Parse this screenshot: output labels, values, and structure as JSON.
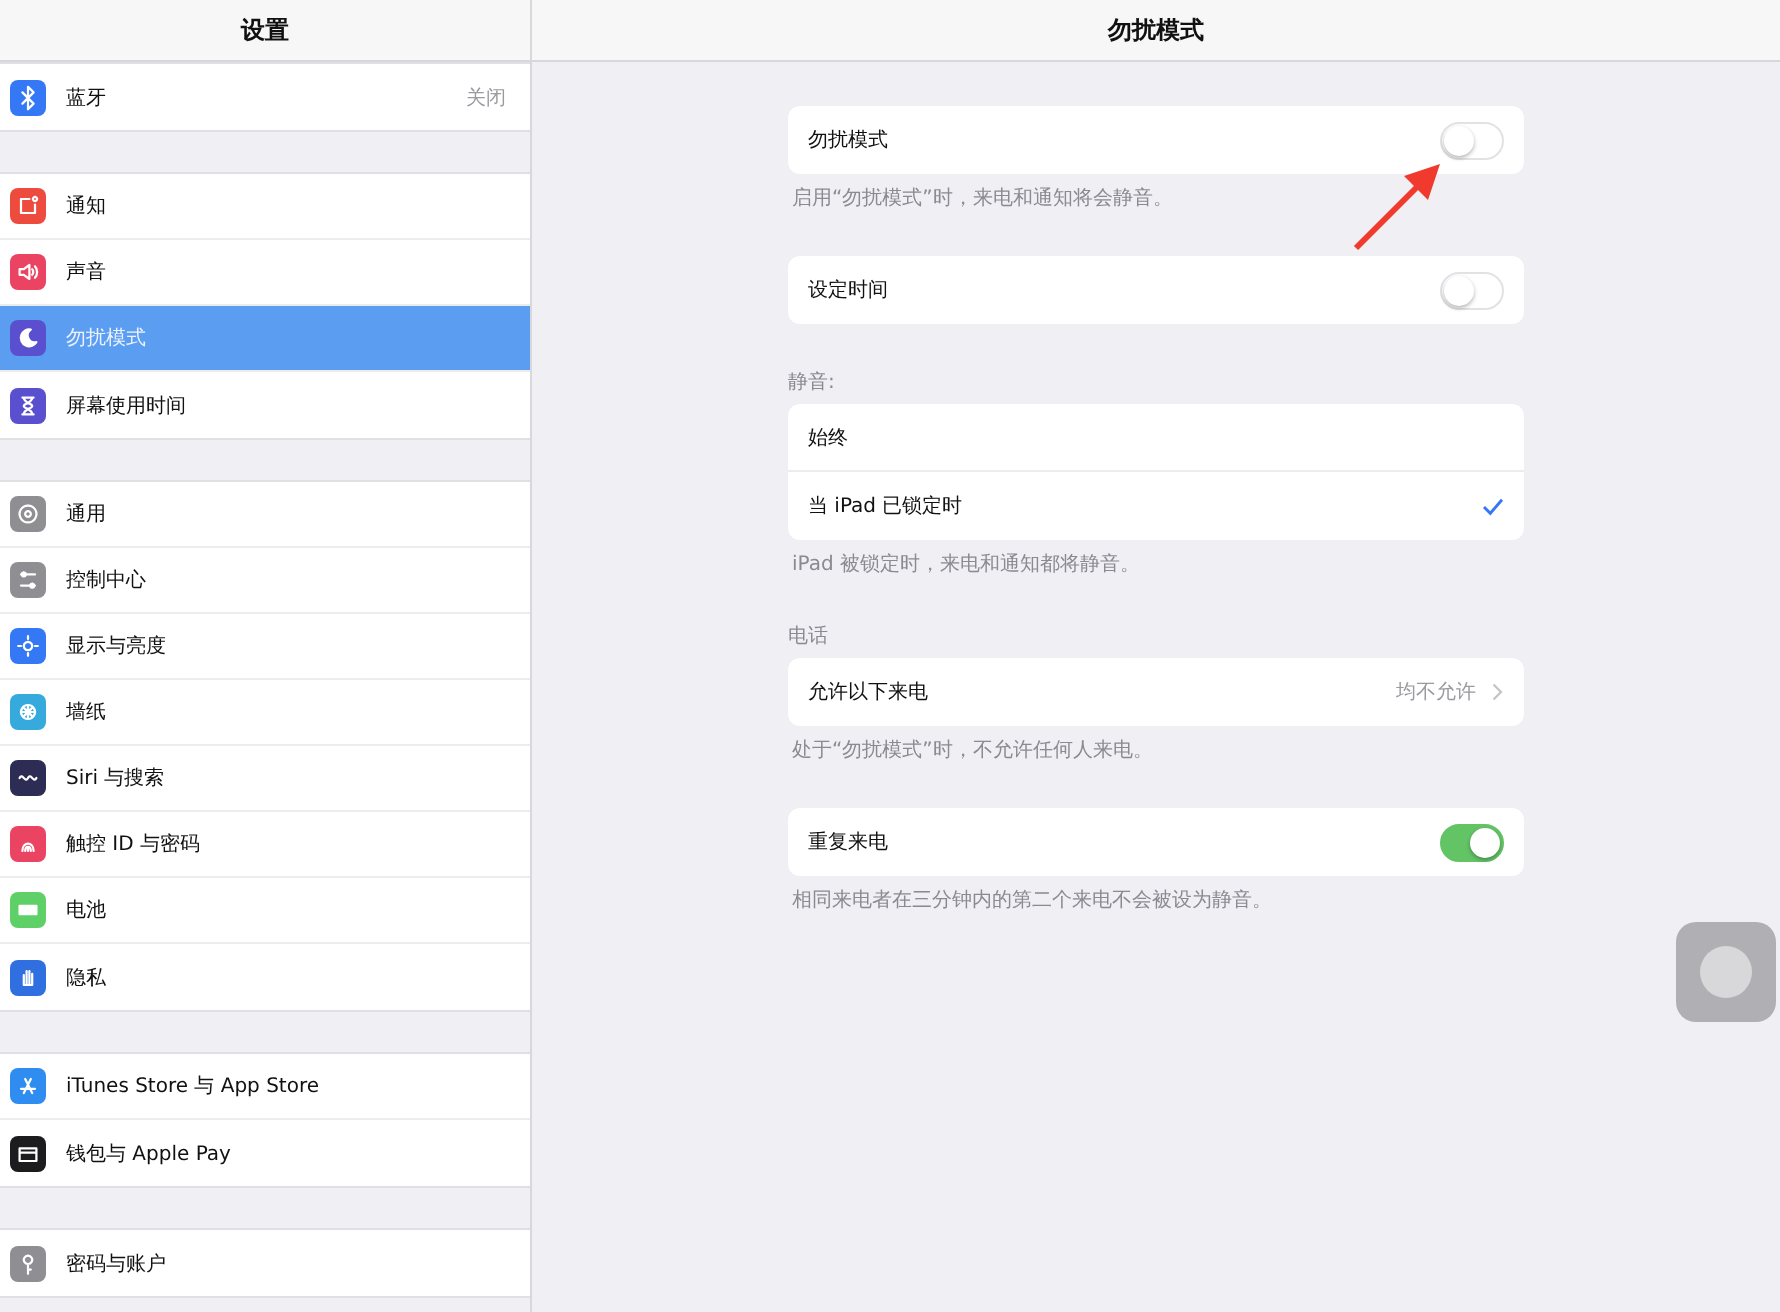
{
  "sidebar": {
    "title": "设置",
    "groups": [
      [
        {
          "label": "蓝牙",
          "value": "关闭",
          "selected": false,
          "color": "#3478f6"
        }
      ],
      [
        {
          "label": "通知",
          "selected": false,
          "color": "#ee4b3f"
        },
        {
          "label": "声音",
          "selected": false,
          "color": "#eb4463"
        },
        {
          "label": "勿扰模式",
          "selected": true,
          "color": "#5a4fcf"
        },
        {
          "label": "屏幕使用时间",
          "selected": false,
          "color": "#5a4fcf"
        }
      ],
      [
        {
          "label": "通用",
          "selected": false,
          "color": "#8e8e93"
        },
        {
          "label": "控制中心",
          "selected": false,
          "color": "#8e8e93"
        },
        {
          "label": "显示与亮度",
          "selected": false,
          "color": "#3478f6"
        },
        {
          "label": "墙纸",
          "selected": false,
          "color": "#36aadc"
        },
        {
          "label": "Siri 与搜索",
          "selected": false,
          "color": "#2c2c54"
        },
        {
          "label": "触控 ID 与密码",
          "selected": false,
          "color": "#eb4463"
        },
        {
          "label": "电池",
          "selected": false,
          "color": "#5fd068"
        },
        {
          "label": "隐私",
          "selected": false,
          "color": "#2f6fe0"
        }
      ],
      [
        {
          "label": "iTunes Store 与 App Store",
          "selected": false,
          "color": "#2f8cf0"
        },
        {
          "label": "钱包与 Apple Pay",
          "selected": false,
          "color": "#1c1c1e"
        }
      ],
      [
        {
          "label": "密码与账户",
          "selected": false,
          "color": "#8e8e93"
        }
      ]
    ]
  },
  "detail": {
    "title": "勿扰模式",
    "groups": [
      {
        "rows": [
          {
            "kind": "toggle",
            "label": "勿扰模式",
            "on": false
          }
        ],
        "footer": "启用“勿扰模式”时，来电和通知将会静音。"
      },
      {
        "rows": [
          {
            "kind": "toggle",
            "label": "设定时间",
            "on": false
          }
        ]
      },
      {
        "header": "静音:",
        "rows": [
          {
            "kind": "choice",
            "label": "始终",
            "selected": false
          },
          {
            "kind": "choice",
            "label": "当 iPad 已锁定时",
            "selected": true
          }
        ],
        "footer": "iPad 被锁定时，来电和通知都将静音。"
      },
      {
        "header": "电话",
        "rows": [
          {
            "kind": "link",
            "label": "允许以下来电",
            "value": "均不允许"
          }
        ],
        "footer": "处于“勿扰模式”时，不允许任何人来电。"
      },
      {
        "rows": [
          {
            "kind": "toggle",
            "label": "重复来电",
            "on": true
          }
        ],
        "footer": "相同来电者在三分钟内的第二个来电不会被设为静音。"
      }
    ]
  }
}
